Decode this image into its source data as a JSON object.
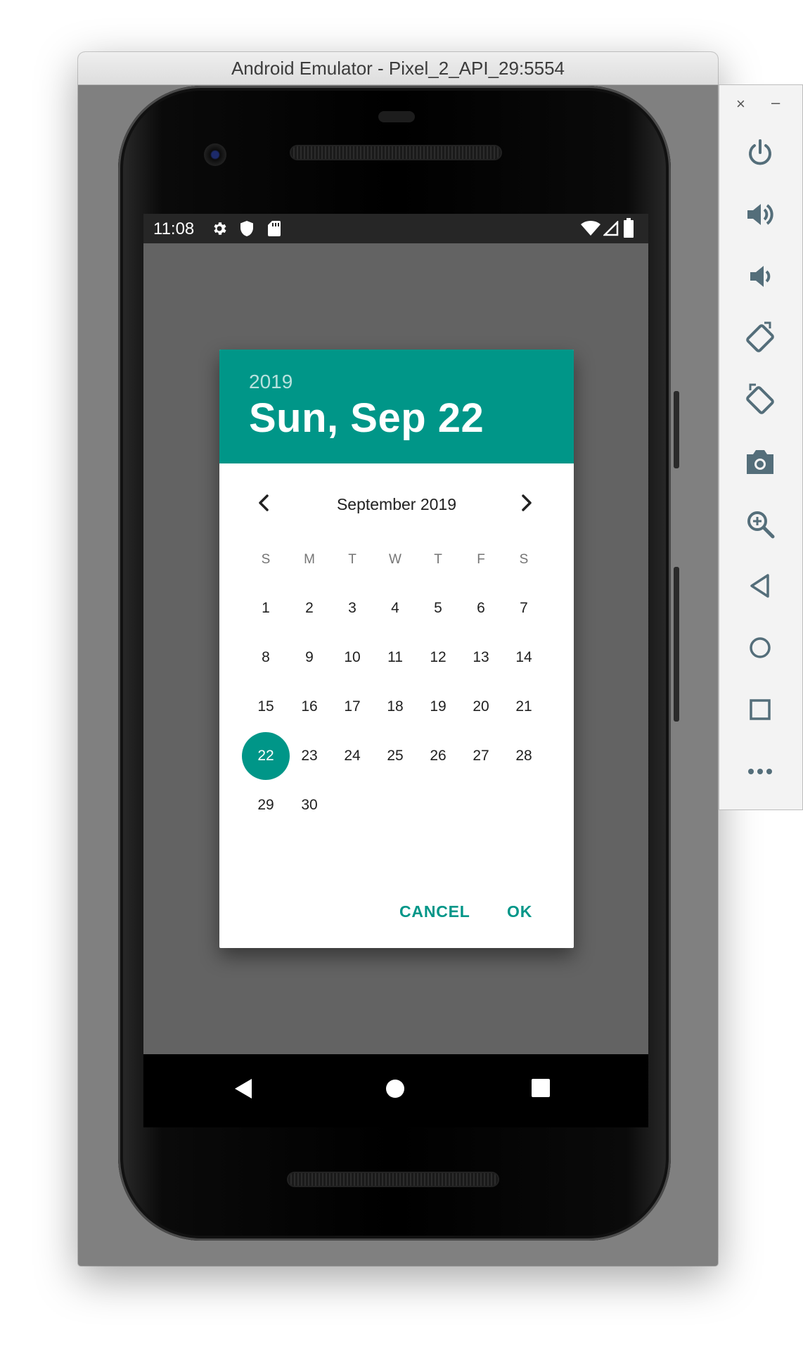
{
  "window": {
    "title": "Android Emulator - Pixel_2_API_29:5554"
  },
  "status_bar": {
    "time": "11:08",
    "left_icons": [
      "settings-icon",
      "shield-icon",
      "sd-card-icon"
    ],
    "right_icons": [
      "wifi-icon",
      "signal-icon",
      "battery-icon"
    ]
  },
  "date_picker": {
    "year": "2019",
    "selected_date": "Sun, Sep 22",
    "month_label": "September 2019",
    "weekdays": [
      "S",
      "M",
      "T",
      "W",
      "T",
      "F",
      "S"
    ],
    "first_day_offset": 0,
    "days_in_month": 30,
    "selected_day": 22,
    "cancel_label": "CANCEL",
    "ok_label": "OK",
    "accent_color": "#009688"
  },
  "nav_bar": {
    "buttons": [
      "back-icon",
      "home-icon",
      "recents-icon"
    ]
  },
  "toolbar": {
    "close_label": "×",
    "minimize_label": "–",
    "items": [
      "power-icon",
      "volume-up-icon",
      "volume-down-icon",
      "rotate-left-icon",
      "rotate-right-icon",
      "camera-icon",
      "zoom-icon",
      "back-icon",
      "home-icon",
      "overview-icon",
      "more-icon"
    ]
  }
}
